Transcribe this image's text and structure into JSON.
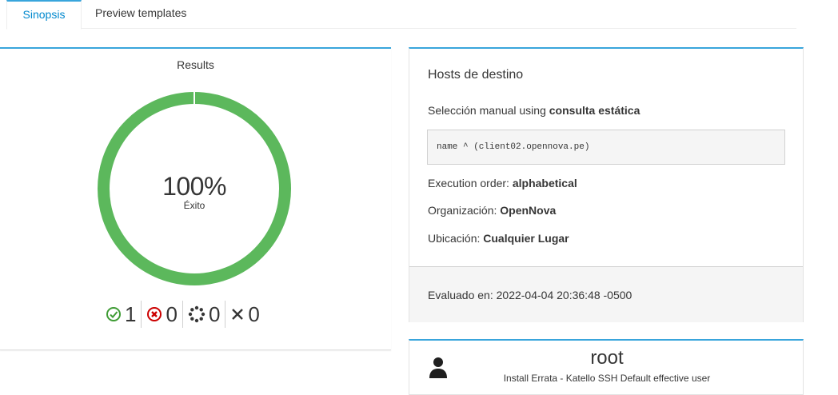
{
  "tabs": [
    {
      "label": "Sinopsis",
      "active": true
    },
    {
      "label": "Preview templates",
      "active": false
    }
  ],
  "results": {
    "title": "Results",
    "percent_text": "100%",
    "percent_value": 100,
    "status_label": "Éxito",
    "success_color": "#5cb85c",
    "stats": [
      {
        "icon": "check-circle-icon",
        "count": "1",
        "color": "#3f9c35"
      },
      {
        "icon": "error-circle-icon",
        "count": "0",
        "color": "#cc0000"
      },
      {
        "icon": "pending-spinner-icon",
        "count": "0",
        "color": "#363636"
      },
      {
        "icon": "cancel-x-icon",
        "count": "0",
        "color": "#363636"
      }
    ]
  },
  "hosts": {
    "title": "Hosts de destino",
    "selection_prefix": "Selección manual using",
    "selection_type": "consulta estática",
    "query": "name ^ (client02.opennova.pe)",
    "execution_order_label": "Execution order:",
    "execution_order_value": "alphabetical",
    "organization_label": "Organización:",
    "organization_value": "OpenNova",
    "location_label": "Ubicación:",
    "location_value": "Cualquier Lugar",
    "evaluated_text": "Evaluado en: 2022-04-04 20:36:48 -0500"
  },
  "user": {
    "icon": "user-icon",
    "name": "root",
    "description": "Install Errata - Katello SSH Default effective user"
  },
  "colors": {
    "accent": "#39a5dc",
    "tab_active_text": "#0088ce"
  }
}
